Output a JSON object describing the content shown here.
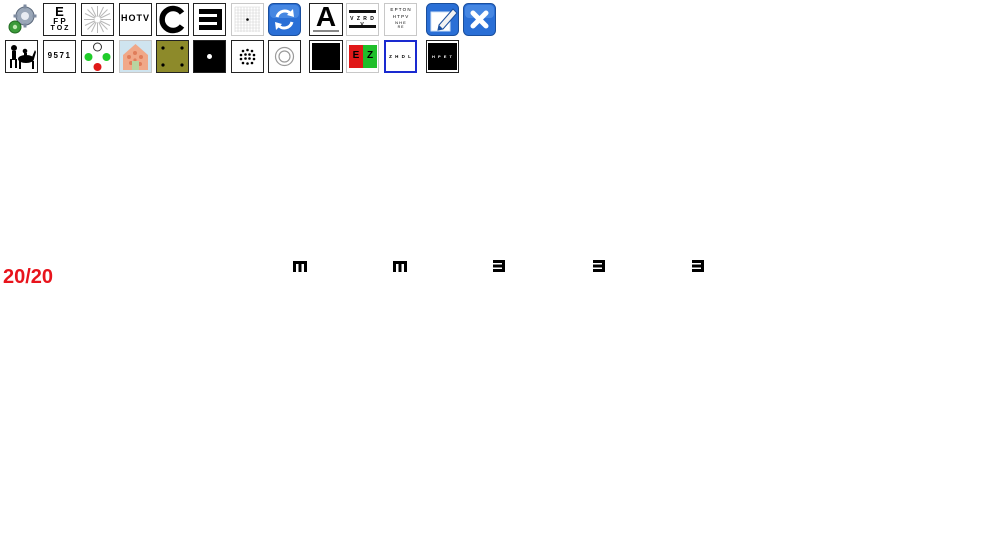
{
  "toolbar": {
    "row1": {
      "snellen_letters": {
        "line1": "E",
        "line2": "F P",
        "line3": "T O Z"
      },
      "hotv_label": "HOTV",
      "single_letter": "A",
      "line_chart_text": "V Z R D V",
      "pyramid_lines": [
        "E P T O N",
        "H T P V",
        "N H E",
        "R E"
      ]
    },
    "row2": {
      "numbers_label": "9571",
      "ez_tile": {
        "left": "E",
        "right": "Z"
      },
      "small_line_text": "Z H D L",
      "dark_line_text": "H P E T"
    }
  },
  "display": {
    "acuity": "20/20",
    "optotypes": [
      {
        "glyph": "E",
        "orientation": "down"
      },
      {
        "glyph": "E",
        "orientation": "down"
      },
      {
        "glyph": "E",
        "orientation": "left"
      },
      {
        "glyph": "E",
        "orientation": "left"
      },
      {
        "glyph": "E",
        "orientation": "left"
      }
    ]
  },
  "colors": {
    "acuity_text": "#e8141c",
    "selected_border": "#1a2ad0",
    "app_icon_blue": "#2a6fd6"
  }
}
